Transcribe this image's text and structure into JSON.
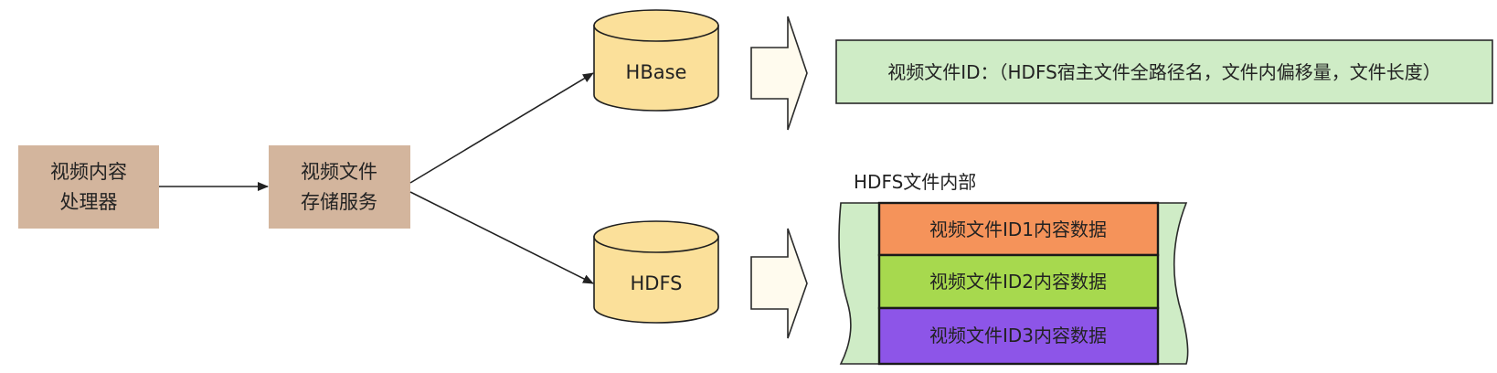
{
  "nodes": {
    "processor": {
      "line1": "视频内容",
      "line2": "处理器"
    },
    "storage_service": {
      "line1": "视频文件",
      "line2": "存储服务"
    },
    "hbase": {
      "label": "HBase"
    },
    "hdfs": {
      "label": "HDFS"
    }
  },
  "hbase_record": {
    "text": "视频文件ID：（HDFS宿主文件全路径名，文件内偏移量，文件长度）"
  },
  "hdfs_file": {
    "title": "HDFS文件内部",
    "segments": [
      {
        "label": "视频文件ID1内容数据",
        "color": "#f5935a"
      },
      {
        "label": "视频文件ID2内容数据",
        "color": "#a7d94e"
      },
      {
        "label": "视频文件ID3内容数据",
        "color": "#8d55e8"
      }
    ]
  },
  "colors": {
    "process_box": "#d3b59d",
    "cylinder": "#fbe09a",
    "record_box": "#cfecc6",
    "big_arrow": "#fffbee"
  }
}
